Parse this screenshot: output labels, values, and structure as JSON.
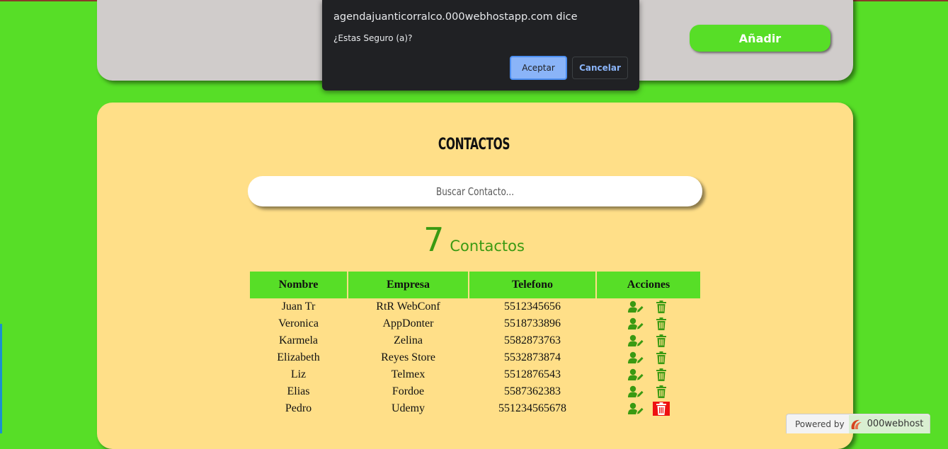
{
  "form": {
    "add_button": "Añadir"
  },
  "contacts": {
    "title": "CONTACTOS",
    "search_placeholder": "Buscar Contacto...",
    "count": "7",
    "count_label": "Contactos",
    "columns": [
      "Nombre",
      "Empresa",
      "Telefono",
      "Acciones"
    ],
    "rows": [
      {
        "nombre": "Juan Tr",
        "empresa": "RtR WebConf",
        "telefono": "5512345656"
      },
      {
        "nombre": "Veronica",
        "empresa": "AppDonter",
        "telefono": "5518733896"
      },
      {
        "nombre": "Karmela",
        "empresa": "Zelina",
        "telefono": "5582873763"
      },
      {
        "nombre": "Elizabeth",
        "empresa": "Reyes Store",
        "telefono": "5532873874"
      },
      {
        "nombre": "Liz",
        "empresa": "Telmex",
        "telefono": "5512876543"
      },
      {
        "nombre": "Elias",
        "empresa": "Fordoe",
        "telefono": "5587362383"
      },
      {
        "nombre": "Pedro",
        "empresa": "Udemy",
        "telefono": "551234565678"
      }
    ],
    "action_icons": [
      "user-edit-icon",
      "trash-icon"
    ],
    "highlighted_delete_row": 6
  },
  "dialog": {
    "title": "agendajuanticorralco.000webhostapp.com dice",
    "message": "¿Estas Seguro (a)?",
    "accept_label": "Aceptar",
    "cancel_label": "Cancelar"
  },
  "footer_badge": {
    "powered_by": "Powered by",
    "brand": "000webhost"
  },
  "colors": {
    "background": "#57de27",
    "form_card": "#d0cccb",
    "contacts_card": "#ffdf88",
    "accent_green": "#57de27",
    "icon_green": "#3a9a12",
    "delete_highlight": "#ee1111",
    "dialog_bg": "#202124",
    "dialog_accent": "#8ab4f8"
  }
}
